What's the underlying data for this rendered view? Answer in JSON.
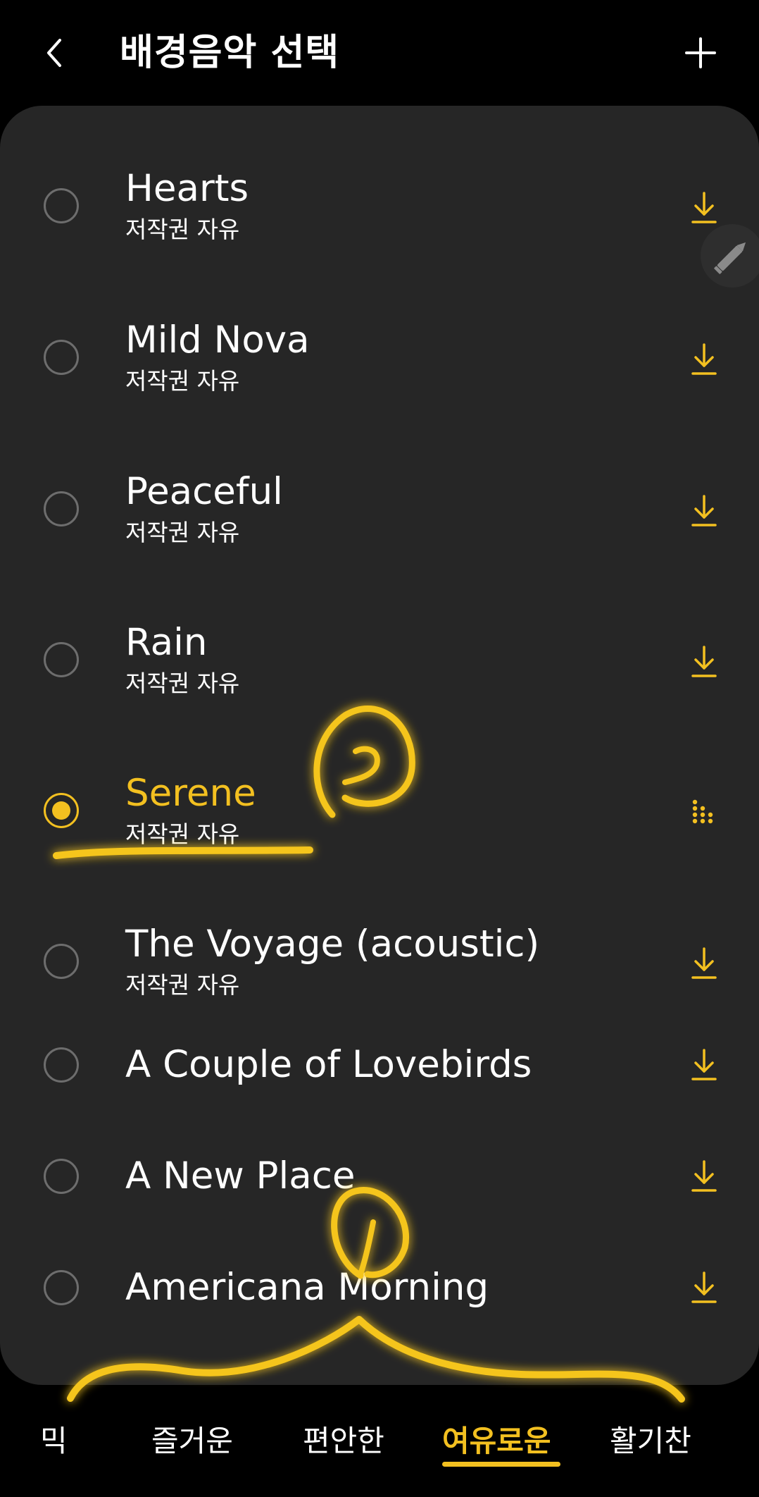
{
  "header": {
    "title": "배경음악 선택",
    "back_icon": "chevron-left-icon",
    "add_icon": "plus-icon"
  },
  "tracks": [
    {
      "title": "Hearts",
      "subtitle": "저작권 자유",
      "selected": false,
      "action_icon": "download-icon"
    },
    {
      "title": "Mild Nova",
      "subtitle": "저작권 자유",
      "selected": false,
      "action_icon": "download-icon"
    },
    {
      "title": "Peaceful",
      "subtitle": "저작권 자유",
      "selected": false,
      "action_icon": "download-icon"
    },
    {
      "title": "Rain",
      "subtitle": "저작권 자유",
      "selected": false,
      "action_icon": "download-icon"
    },
    {
      "title": "Serene",
      "subtitle": "저작권 자유",
      "selected": true,
      "action_icon": "equalizer-icon"
    },
    {
      "title": "The Voyage (acoustic)",
      "subtitle": "저작권 자유",
      "selected": false,
      "action_icon": "download-icon"
    },
    {
      "title": "A Couple of Lovebirds",
      "subtitle": "",
      "selected": false,
      "action_icon": "download-icon"
    },
    {
      "title": "A New Place",
      "subtitle": "",
      "selected": false,
      "action_icon": "download-icon"
    },
    {
      "title": "Americana Morning",
      "subtitle": "",
      "selected": false,
      "action_icon": "download-icon"
    }
  ],
  "tabs": [
    {
      "label": "믹",
      "active": false
    },
    {
      "label": "즐거운",
      "active": false
    },
    {
      "label": "편안한",
      "active": false
    },
    {
      "label": "여유로운",
      "active": true
    },
    {
      "label": "활기찬",
      "active": false
    }
  ],
  "colors": {
    "accent": "#f3c020",
    "panel": "#262626",
    "background": "#000000"
  },
  "edit_icon": "pencil-icon"
}
